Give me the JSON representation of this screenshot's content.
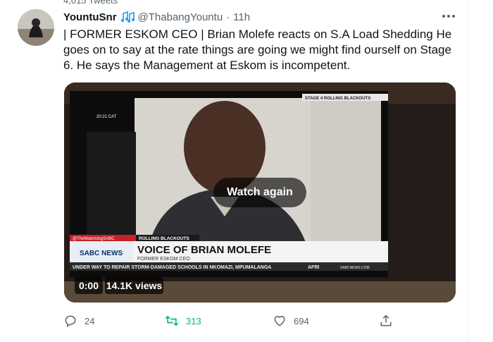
{
  "top_strip": {
    "tweet_count": "4,015 Tweets"
  },
  "tweet": {
    "author_name": "YountuSnr",
    "handle": "@ThabangYountu",
    "separator": "·",
    "time": "11h",
    "text": "| FORMER ESKOM CEO | Brian Molefe reacts on S.A Load Shedding He goes on to say at the rate things are going we might find ourself on Stage 6. He says the Management at Eskom is incompetent.",
    "icons": {
      "music": "music-notes-icon",
      "more": "more-icon"
    }
  },
  "video": {
    "overlay_button": "Watch again",
    "duration": "0:00",
    "views": "14.1K views",
    "screen": {
      "top_right_banner": "STAGE 4 ROLLING BLACKOUTS",
      "clock": "20:21 CAT",
      "twitter_tag": "@TheWatchdogSABC",
      "strap_label": "ROLLING BLACKOUTS",
      "channel_logo": "SABC NEWS",
      "headline": "VOICE OF BRIAN MOLEFE",
      "subheadline": "FORMER ESKOM CEO",
      "ticker": "UNDER WAY TO REPAIR STORM-DAMAGED SCHOOLS IN NKOMAZI, MPUMALANGA",
      "ticker_tag": "AFRI",
      "ticker_site": "SABCNEWS.COM"
    }
  },
  "actions": {
    "reply": {
      "icon": "reply-icon",
      "count": "24"
    },
    "retweet": {
      "icon": "retweet-icon",
      "count": "313"
    },
    "like": {
      "icon": "heart-icon",
      "count": "694"
    },
    "share": {
      "icon": "share-icon"
    }
  },
  "colors": {
    "text": "#0f1419",
    "secondary": "#536471",
    "retweet": "#00ba7c",
    "border": "#eff3f4"
  }
}
